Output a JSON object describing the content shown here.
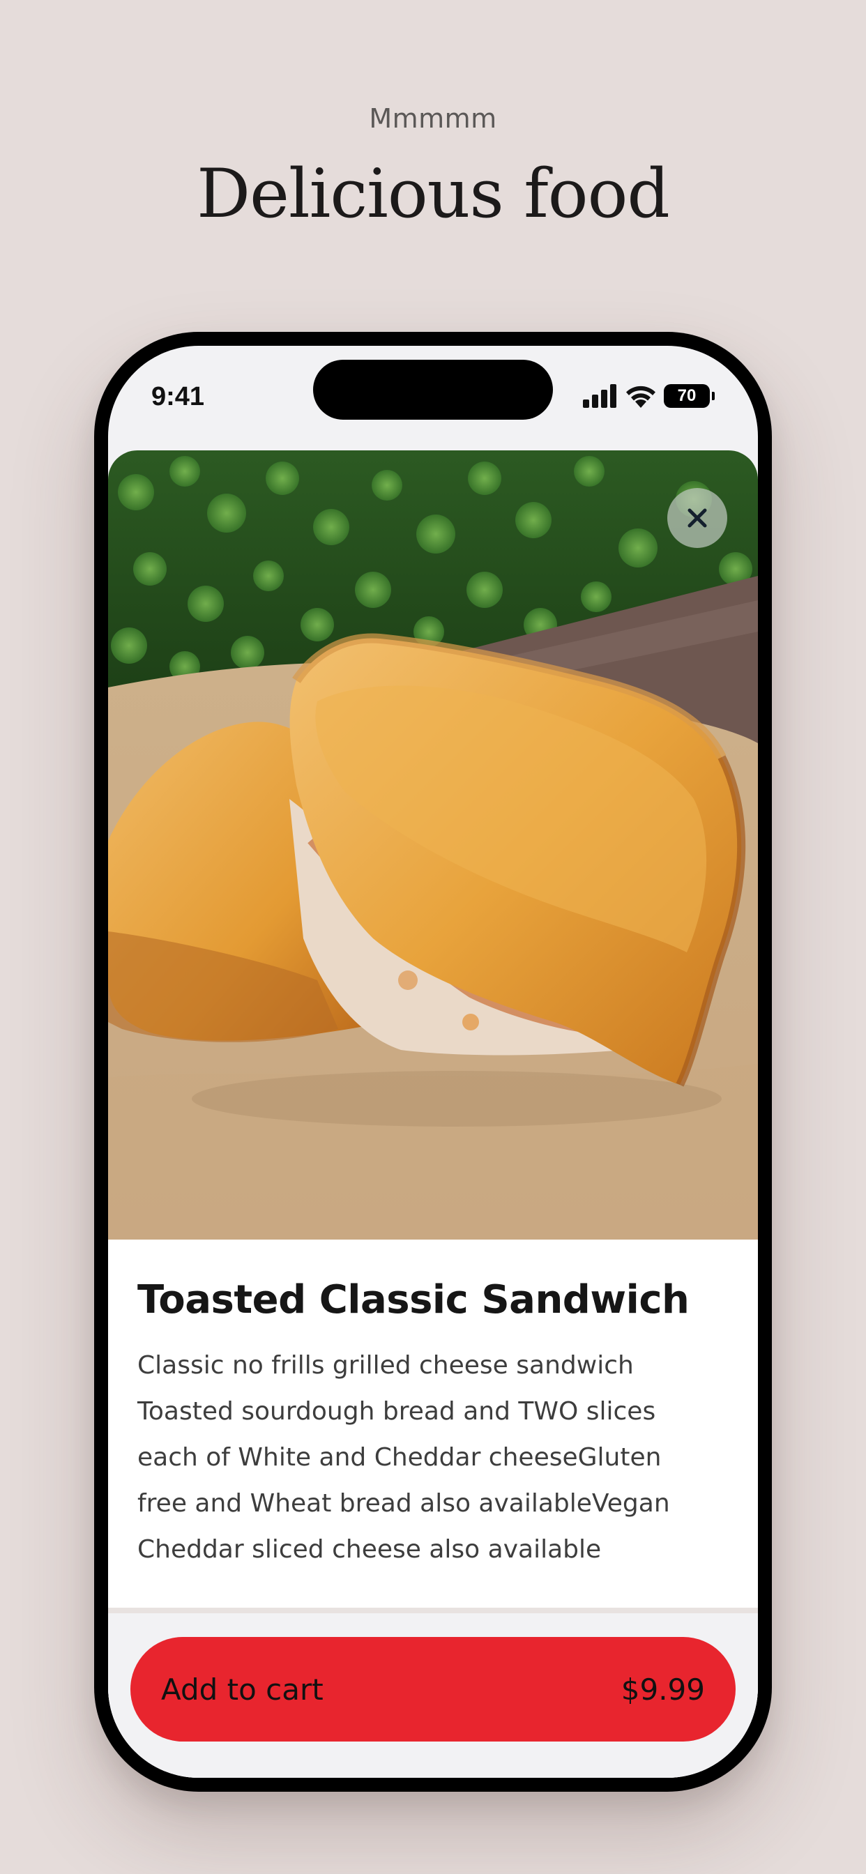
{
  "page": {
    "eyebrow": "Mmmmm",
    "headline": "Delicious food"
  },
  "status_bar": {
    "time": "9:41",
    "battery_level": "70",
    "icons": [
      "signal-icon",
      "wifi-icon",
      "battery-icon"
    ]
  },
  "product": {
    "title": "Toasted Classic Sandwich",
    "description": "Classic no frills grilled cheese sandwich Toasted sourdough bread and TWO slices each of White and Cheddar cheeseGluten free and Wheat bread also availableVegan Cheddar sliced cheese also available",
    "image": "grilled-cheese-sandwich-photo"
  },
  "actions": {
    "close_icon": "close-icon",
    "add_to_cart_label": "Add to cart",
    "price": "$9.99"
  },
  "colors": {
    "background": "#e5dcda",
    "accent": "#e8252e",
    "text": "#161616"
  }
}
